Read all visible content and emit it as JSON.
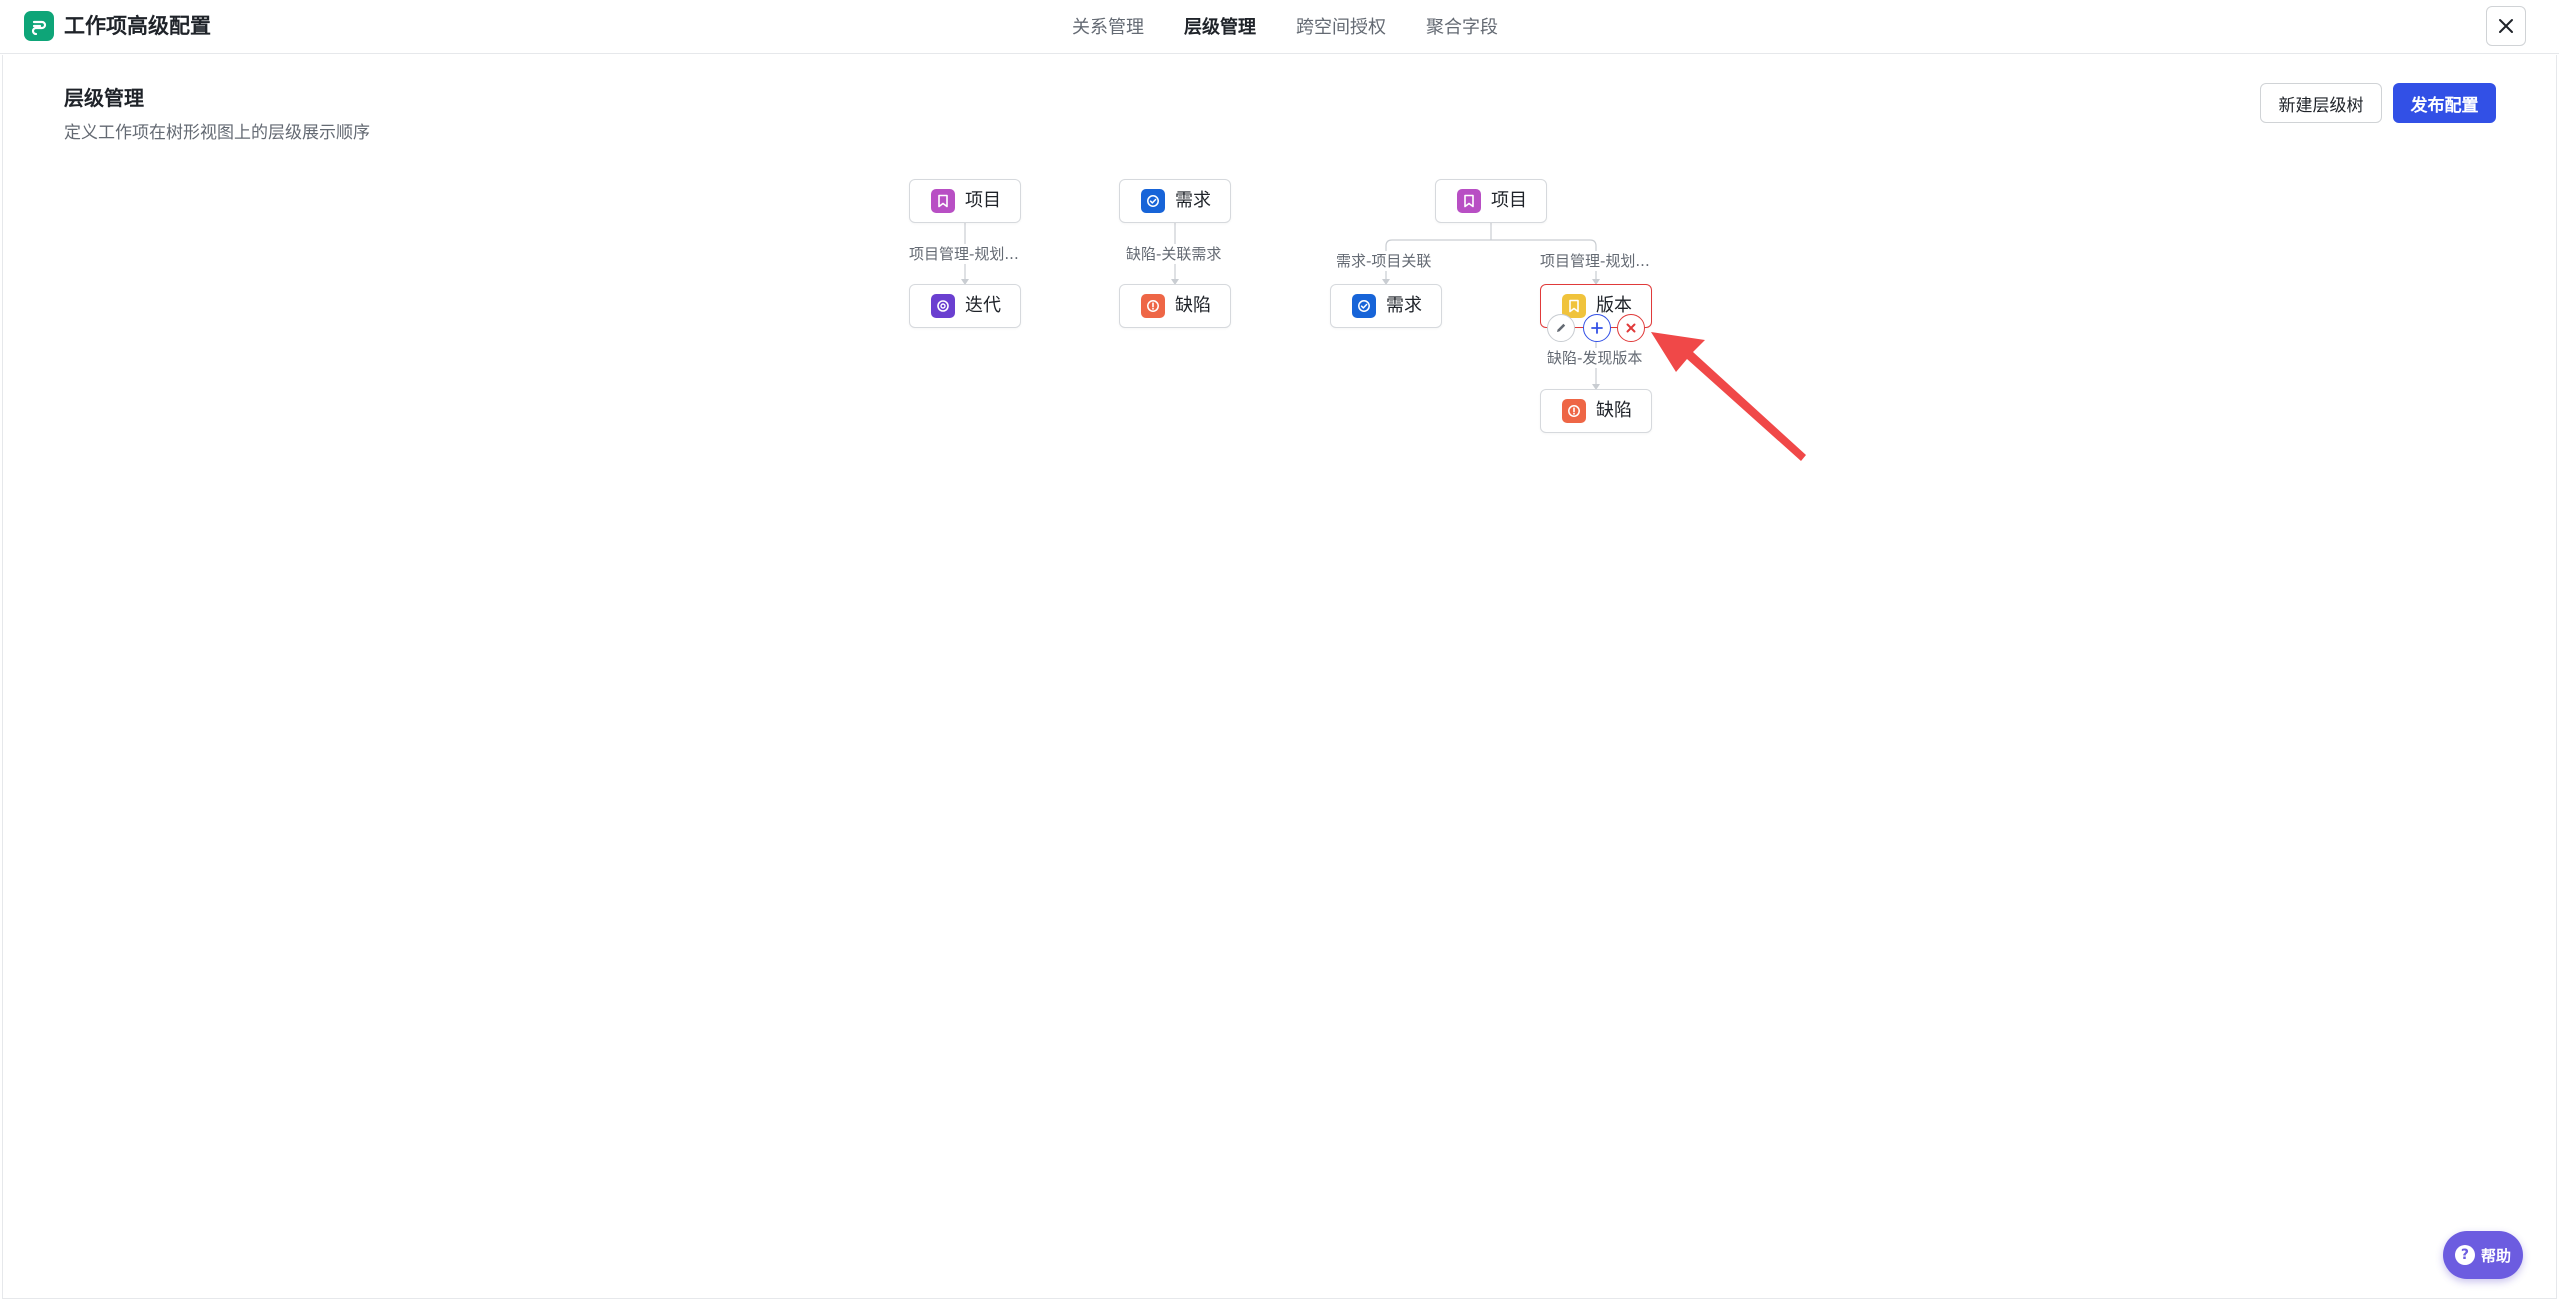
{
  "header": {
    "app_title": "工作项高级配置",
    "tabs": [
      {
        "label": "关系管理"
      },
      {
        "label": "层级管理"
      },
      {
        "label": "跨空间授权"
      },
      {
        "label": "聚合字段"
      }
    ],
    "active_tab": "层级管理"
  },
  "page": {
    "title": "层级管理",
    "description": "定义工作项在树形视图上的层级展示顺序",
    "new_tree_label": "新建层级树",
    "publish_label": "发布配置"
  },
  "trees": [
    {
      "root": {
        "label": "项目",
        "icon": "bookmark-icon",
        "color": "#b84fc4"
      },
      "edge_label": "项目管理-规划...",
      "child": {
        "label": "迭代",
        "icon": "sprint-icon",
        "color": "#6a3fd0"
      }
    },
    {
      "root": {
        "label": "需求",
        "icon": "check-circle-icon",
        "color": "#1764d8"
      },
      "edge_label": "缺陷-关联需求",
      "child": {
        "label": "缺陷",
        "icon": "alert-icon",
        "color": "#ee6646"
      }
    },
    {
      "root": {
        "label": "项目",
        "icon": "bookmark-icon",
        "color": "#b84fc4"
      },
      "left": {
        "edge_label": "需求-项目关联",
        "node": {
          "label": "需求",
          "icon": "check-circle-icon",
          "color": "#1764d8"
        }
      },
      "right": {
        "edge_label": "项目管理-规划...",
        "node": {
          "label": "版本",
          "icon": "bookmark-icon",
          "color": "#f0c33c"
        },
        "child_edge_label": "缺陷-发现版本",
        "child": {
          "label": "缺陷",
          "icon": "alert-icon",
          "color": "#ee6646"
        }
      }
    }
  ],
  "node_actions": [
    "edit-icon",
    "plus-icon",
    "close-icon"
  ],
  "help": {
    "label": "帮助"
  },
  "colors": {
    "primary": "#3250e6",
    "danger": "#e03a3a",
    "logo": "#0ea578",
    "help": "#6c5ce0",
    "annotation_arrow": "#f04848"
  }
}
